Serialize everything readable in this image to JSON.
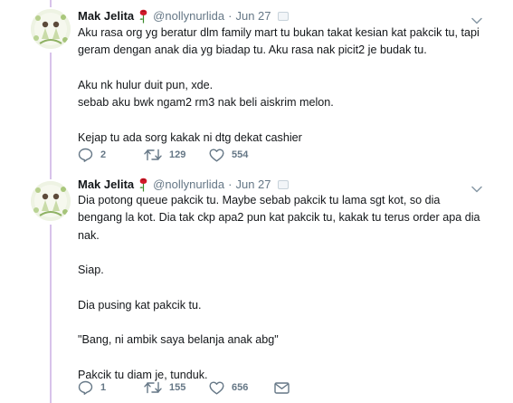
{
  "tweets": [
    {
      "author_name": "Mak Jelita",
      "handle": "@nollynurlida",
      "date": "Jun 27",
      "separator": "·",
      "lines": [
        "Aku rasa org yg beratur dlm family mart tu bukan takat kesian kat pakcik tu, tapi",
        "geram dengan anak dia yg biadap tu. Aku rasa nak picit2 je budak tu.",
        "",
        "Aku nk hulur duit pun, xde.",
        "sebab aku bwk ngam2 rm3 nak beli aiskrim melon.",
        "",
        "Kejap tu ada sorg kakak ni dtg dekat cashier"
      ],
      "replies": "2",
      "retweets": "129",
      "likes": "554"
    },
    {
      "author_name": "Mak Jelita",
      "handle": "@nollynurlida",
      "date": "Jun 27",
      "separator": "·",
      "lines": [
        "Dia potong queue pakcik tu. Maybe sebab pakcik tu lama sgt kot, so dia",
        "bengang la kot. Dia tak ckp apa2 pun kat pakcik tu, kakak tu terus order apa dia",
        "nak.",
        "",
        "Siap.",
        "",
        "Dia pusing kat pakcik tu.",
        "",
        "\"Bang, ni ambik saya belanja anak abg\"",
        "",
        "Pakcik tu diam je, tunduk."
      ],
      "replies": "1",
      "retweets": "155",
      "likes": "656"
    }
  ],
  "icons": {
    "emoji": "rose-icon",
    "badge": "media-badge-icon",
    "menu": "chevron-down-icon",
    "reply": "reply-icon",
    "retweet": "retweet-icon",
    "like": "heart-icon",
    "message": "direct-message-icon"
  },
  "colors": {
    "thread_line": "#d8c3ea",
    "secondary_text": "#657786",
    "primary_text": "#14171a"
  }
}
